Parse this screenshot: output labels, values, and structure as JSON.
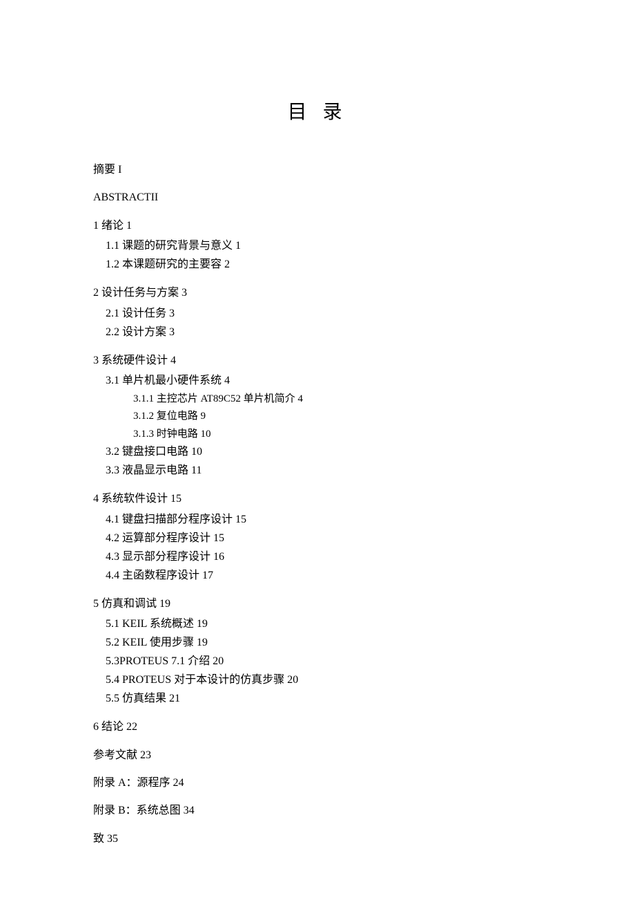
{
  "title": "目 录",
  "entries": {
    "abstract_cn": "摘要 I",
    "abstract_en": "ABSTRACTII",
    "ch1": "1  绪论 1",
    "ch1_1": "1.1 课题的研究背景与意义 1",
    "ch1_2": "1.2 本课题研究的主要容 2",
    "ch2": "2 设计任务与方案 3",
    "ch2_1": "2.1 设计任务 3",
    "ch2_2": "2.2 设计方案 3",
    "ch3": "3  系统硬件设计 4",
    "ch3_1": "3.1 单片机最小硬件系统 4",
    "ch3_1_1": "3.1.1 主控芯片 AT89C52 单片机简介 4",
    "ch3_1_2": "3.1.2 复位电路 9",
    "ch3_1_3": "3.1.3 时钟电路 10",
    "ch3_2": "3.2 键盘接口电路 10",
    "ch3_3": "3.3 液晶显示电路 11",
    "ch4": "4 系统软件设计 15",
    "ch4_1": "4.1 键盘扫描部分程序设计 15",
    "ch4_2": "4.2 运算部分程序设计 15",
    "ch4_3": "4.3 显示部分程序设计 16",
    "ch4_4": "4.4 主函数程序设计 17",
    "ch5": "5 仿真和调试 19",
    "ch5_1": "5.1  KEIL 系统概述 19",
    "ch5_2": "5.2 KEIL 使用步骤 19",
    "ch5_3": "5.3PROTEUS 7.1 介绍 20",
    "ch5_4": "5.4 PROTEUS 对于本设计的仿真步骤 20",
    "ch5_5": "5.5 仿真结果 21",
    "ch6": "6  结论 22",
    "references": "参考文献 23",
    "appendix_a": "附录 A：源程序 24",
    "appendix_b": "附录 B：系统总图 34",
    "acknowledgment": "致 35"
  }
}
